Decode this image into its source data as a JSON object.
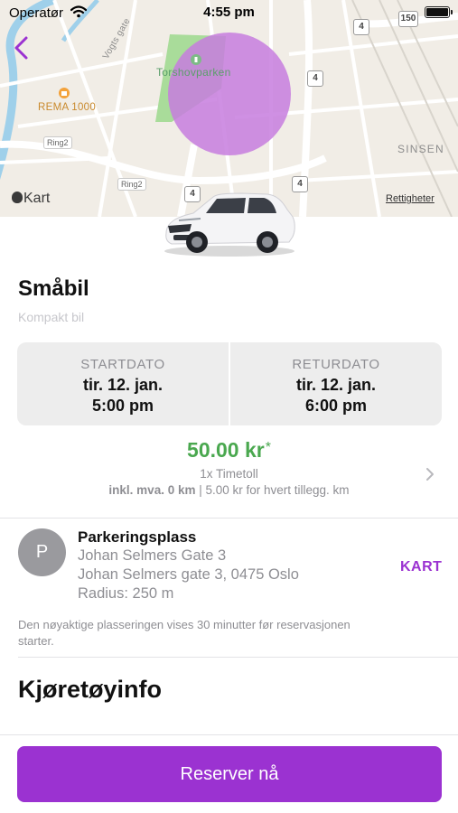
{
  "status_bar": {
    "carrier": "Operatør",
    "time": "4:55 pm"
  },
  "map": {
    "park_name": "Torshovparken",
    "store_name": "REMA 1000",
    "district": "SINSEN",
    "street_name": "Vogts gate",
    "ring_road_a": "Ring2",
    "ring_road_b": "Ring2",
    "route_shields": [
      "4",
      "4",
      "4",
      "4",
      "150"
    ],
    "attribution": "Kart",
    "legal_link": "Rettigheter",
    "radius_color": "#c77dde"
  },
  "vehicle": {
    "category": "Småbil",
    "description": "Kompakt bil"
  },
  "dates": {
    "start_label": "STARTDATO",
    "start_day": "tir. 12. jan.",
    "start_time": "5:00 pm",
    "return_label": "RETURDATO",
    "return_day": "tir. 12. jan.",
    "return_time": "6:00 pm"
  },
  "pricing": {
    "price": "50.00 kr",
    "price_marker": "*",
    "unit": "1x Timetoll",
    "terms_bold": "inkl. mva. 0 km",
    "terms_rest": " | 5.00 kr for hvert tillegg. km"
  },
  "parking": {
    "avatar_letter": "P",
    "title": "Parkeringsplass",
    "street": "Johan Selmers Gate 3",
    "address": "Johan Selmers gate 3, 0475 Oslo",
    "radius": "Radius: 250 m",
    "map_link": "KART"
  },
  "location_note": "Den nøyaktige plasseringen vises 30 minutter før reservasjonen starter.",
  "section_title": "Kjøretøyinfo",
  "reserve_button": "Reserver nå",
  "colors": {
    "accent": "#9b32d1",
    "price_green": "#4aa84f",
    "secondary_text": "#8e8e93"
  }
}
